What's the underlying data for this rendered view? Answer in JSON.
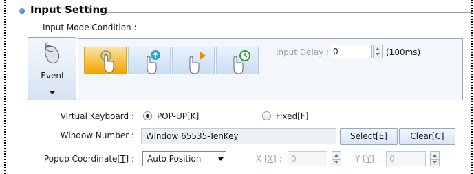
{
  "section": {
    "title": "Input Setting",
    "subtitle": "Input Mode Condition :"
  },
  "event": {
    "label": "Event",
    "icon": "mouse-icon"
  },
  "modes": [
    {
      "name": "touch-icon",
      "active": true
    },
    {
      "name": "touch-up-icon",
      "active": false
    },
    {
      "name": "touch-move-icon",
      "active": false
    },
    {
      "name": "touch-hold-icon",
      "active": false
    }
  ],
  "input_delay": {
    "label": "Input Delay :",
    "value": "0",
    "unit": "(100ms)"
  },
  "virtual_keyboard": {
    "label": "Virtual Keyboard :",
    "popup_label": "POP-UP[K]",
    "fixed_label": "Fixed[F]",
    "selected": "popup"
  },
  "window_number": {
    "label": "Window Number :",
    "value": "Window 65535-TenKey",
    "select_label": "Select[E]",
    "clear_label": "Clear[C]"
  },
  "popup_coordinate": {
    "label": "Popup Coordinate[T] :",
    "selected": "Auto Position",
    "x_label": "X [X] :",
    "x_value": "0",
    "y_label": "Y [Y] :",
    "y_value": "0"
  },
  "colors": {
    "accent_orange": "#f1a400",
    "button_blue": "#d5e4f6",
    "frame": "#8f9aa8"
  }
}
